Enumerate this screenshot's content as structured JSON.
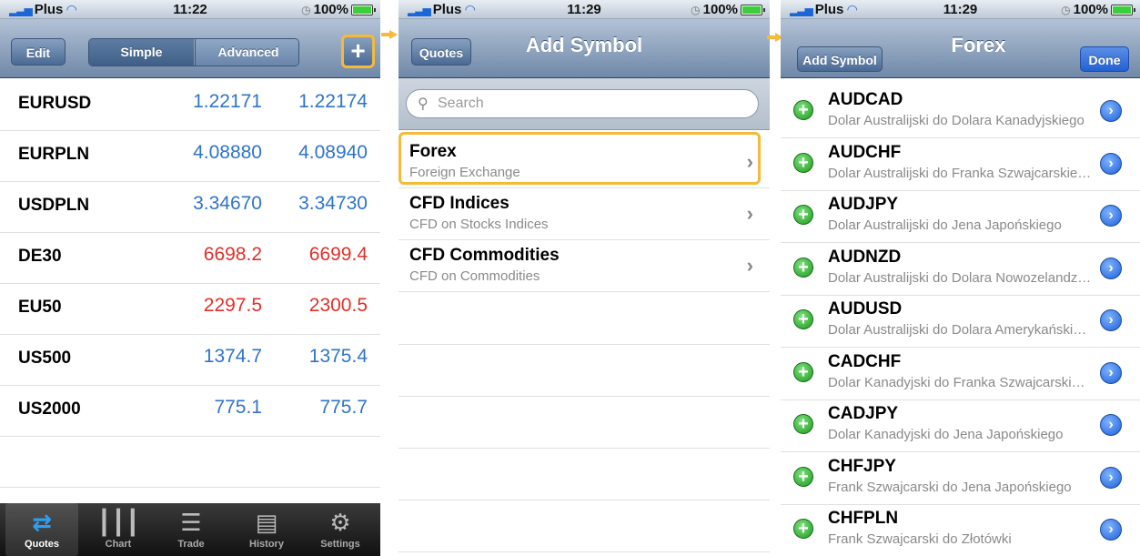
{
  "screen1": {
    "status": {
      "carrier": "Plus",
      "time": "11:22",
      "battery": "100%"
    },
    "nav": {
      "edit": "Edit",
      "simple": "Simple",
      "advanced": "Advanced",
      "plus": "+"
    },
    "quotes": [
      {
        "symbol": "EURUSD",
        "bid": "1.22171",
        "ask": "1.22174",
        "color": "#2f74c9"
      },
      {
        "symbol": "EURPLN",
        "bid": "4.08880",
        "ask": "4.08940",
        "color": "#2f74c9"
      },
      {
        "symbol": "USDPLN",
        "bid": "3.34670",
        "ask": "3.34730",
        "color": "#2f74c9"
      },
      {
        "symbol": "DE30",
        "bid": "6698.2",
        "ask": "6699.4",
        "color": "#e0302a"
      },
      {
        "symbol": "EU50",
        "bid": "2297.5",
        "ask": "2300.5",
        "color": "#e0302a"
      },
      {
        "symbol": "US500",
        "bid": "1374.7",
        "ask": "1375.4",
        "color": "#2f74c9"
      },
      {
        "symbol": "US2000",
        "bid": "775.1",
        "ask": "775.7",
        "color": "#2f74c9"
      }
    ],
    "tabs": [
      {
        "label": "Quotes",
        "icon": "quotes-icon"
      },
      {
        "label": "Chart",
        "icon": "chart-icon"
      },
      {
        "label": "Trade",
        "icon": "trade-icon"
      },
      {
        "label": "History",
        "icon": "history-icon"
      },
      {
        "label": "Settings",
        "icon": "settings-icon"
      }
    ]
  },
  "screen2": {
    "status": {
      "carrier": "Plus",
      "time": "11:29",
      "battery": "100%"
    },
    "nav": {
      "back": "Quotes",
      "title": "Add Symbol"
    },
    "search_placeholder": "Search",
    "categories": [
      {
        "title": "Forex",
        "subtitle": "Foreign Exchange"
      },
      {
        "title": "CFD Indices",
        "subtitle": "CFD on Stocks Indices"
      },
      {
        "title": "CFD Commodities",
        "subtitle": "CFD on Commodities"
      }
    ]
  },
  "screen3": {
    "status": {
      "carrier": "Plus",
      "time": "11:29",
      "battery": "100%"
    },
    "nav": {
      "back": "Add Symbol",
      "title": "Forex",
      "done": "Done"
    },
    "symbols": [
      {
        "symbol": "AUDCAD",
        "name": "Dolar Australijski do Dolara Kanadyjskiego"
      },
      {
        "symbol": "AUDCHF",
        "name": "Dolar Australijski do Franka Szwajcarskiego"
      },
      {
        "symbol": "AUDJPY",
        "name": "Dolar Australijski do Jena Japońskiego"
      },
      {
        "symbol": "AUDNZD",
        "name": "Dolar Australijski do Dolara Nowozelandzkiego"
      },
      {
        "symbol": "AUDUSD",
        "name": "Dolar Australijski do Dolara Amerykańskiego"
      },
      {
        "symbol": "CADCHF",
        "name": "Dolar Kanadyjski do Franka Szwajcarskiego"
      },
      {
        "symbol": "CADJPY",
        "name": "Dolar Kanadyjski do Jena Japońskiego"
      },
      {
        "symbol": "CHFJPY",
        "name": "Frank Szwajcarski do Jena Japońskiego"
      },
      {
        "symbol": "CHFPLN",
        "name": "Frank Szwajcarski do Złotówki"
      }
    ]
  },
  "colors": {
    "highlight": "#f6b93a",
    "bid_up": "#2f74c9",
    "bid_down": "#e0302a"
  }
}
